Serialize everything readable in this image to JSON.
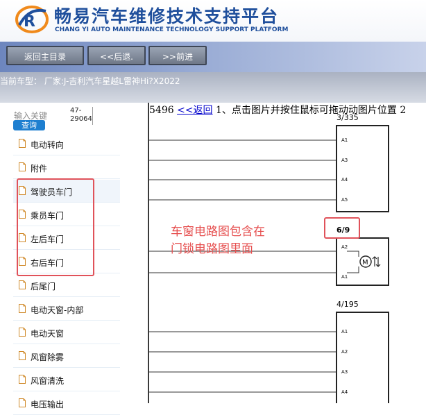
{
  "header": {
    "title": "畅易汽车维修技术支持平台",
    "subtitle": "CHANG YI AUTO MAINTENANCE TECHNOLOGY SUPPORT PLATFORM",
    "logo": "CY"
  },
  "toolbar": {
    "home_label": "返回主目录",
    "back_label": "<<后退.",
    "forward_label": ">>前进"
  },
  "model_bar": {
    "label": "当前车型： 厂家:J-吉利汽车星越L雷神Hi?X2022"
  },
  "search": {
    "label": "输入关键",
    "value_line1": "47-",
    "value_line2": "29064",
    "button_label": "查询"
  },
  "sidebar": {
    "items": [
      {
        "label": "电动转向"
      },
      {
        "label": "附件"
      },
      {
        "label": "驾驶员车门"
      },
      {
        "label": "乘员车门"
      },
      {
        "label": "左后车门"
      },
      {
        "label": "右后车门"
      },
      {
        "label": "后尾门"
      },
      {
        "label": "电动天窗-内部"
      },
      {
        "label": "电动天窗"
      },
      {
        "label": "风窗除雾"
      },
      {
        "label": "风窗清洗"
      },
      {
        "label": "电压输出"
      }
    ]
  },
  "content": {
    "page_number": "5496",
    "back_link": "<<返回",
    "instruction": "1、点击图片并按住鼠标可拖动动图片位置 2",
    "annotation_line1": "车窗电路图包含在",
    "annotation_line2": "门锁电路图里面",
    "diagram": {
      "box1_label": "3/335",
      "box1_pins": [
        "A1",
        "A3",
        "A4",
        "A5"
      ],
      "box2_label": "6/9",
      "box2_pins": [
        "A2",
        "A1"
      ],
      "motor_symbol": "M",
      "box3_label": "4/195",
      "box3_pins": [
        "A1",
        "A2",
        "A3",
        "A4"
      ]
    }
  },
  "colors": {
    "title_blue": "#1f4f9c",
    "highlight_red": "#e0525a",
    "search_button": "#1e7fd0"
  }
}
